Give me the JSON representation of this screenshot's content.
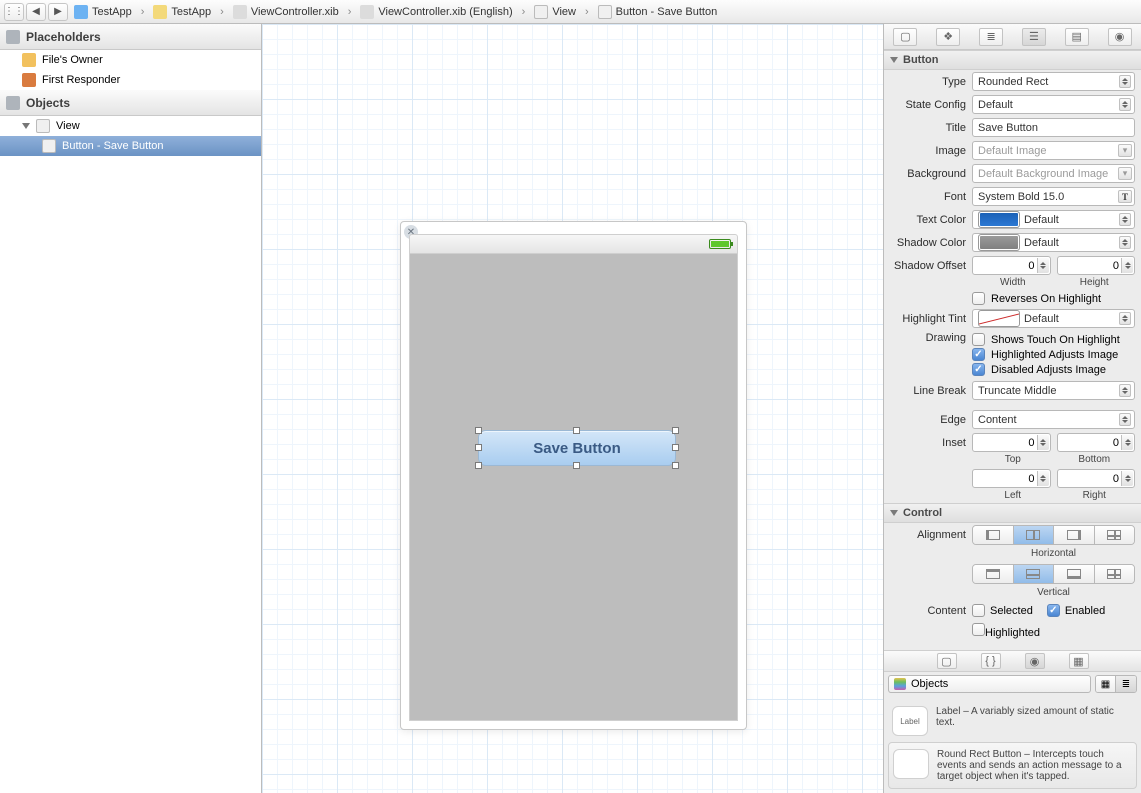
{
  "breadcrumb": {
    "items": [
      {
        "label": "TestApp"
      },
      {
        "label": "TestApp"
      },
      {
        "label": "ViewController.xib"
      },
      {
        "label": "ViewController.xib (English)"
      },
      {
        "label": "View"
      },
      {
        "label": "Button - Save Button"
      }
    ]
  },
  "outline": {
    "placeholders_title": "Placeholders",
    "files_owner": "File's Owner",
    "first_responder": "First Responder",
    "objects_title": "Objects",
    "view": "View",
    "button_item": "Button - Save Button"
  },
  "canvas": {
    "button_title": "Save Button"
  },
  "inspector": {
    "section_button": "Button",
    "type_label": "Type",
    "type_value": "Rounded Rect",
    "stateconfig_label": "State Config",
    "stateconfig_value": "Default",
    "title_label": "Title",
    "title_value": "Save Button",
    "image_label": "Image",
    "image_placeholder": "Default Image",
    "background_label": "Background",
    "background_placeholder": "Default Background Image",
    "font_label": "Font",
    "font_value": "System Bold 15.0",
    "textcolor_label": "Text Color",
    "textcolor_value": "Default",
    "shadowcolor_label": "Shadow Color",
    "shadowcolor_value": "Default",
    "shadowoffset_label": "Shadow Offset",
    "shadowoffset_width": "0",
    "shadowoffset_height": "0",
    "shadowoffset_w_lbl": "Width",
    "shadowoffset_h_lbl": "Height",
    "reverses_label": "Reverses On Highlight",
    "highlight_tint_label": "Highlight Tint",
    "highlight_tint_value": "Default",
    "drawing_label": "Drawing",
    "shows_touch": "Shows Touch On Highlight",
    "hl_adjusts": "Highlighted Adjusts Image",
    "dis_adjusts": "Disabled Adjusts Image",
    "linebreak_label": "Line Break",
    "linebreak_value": "Truncate Middle",
    "edge_label": "Edge",
    "edge_value": "Content",
    "inset_label": "Inset",
    "inset_top": "0",
    "inset_bottom": "0",
    "inset_top_lbl": "Top",
    "inset_bottom_lbl": "Bottom",
    "inset_left": "0",
    "inset_right": "0",
    "inset_left_lbl": "Left",
    "inset_right_lbl": "Right",
    "section_control": "Control",
    "alignment_label": "Alignment",
    "horizontal": "Horizontal",
    "vertical": "Vertical",
    "content_label": "Content",
    "selected": "Selected",
    "enabled": "Enabled",
    "highlighted": "Highlighted"
  },
  "library": {
    "objects_label": "Objects",
    "label_title": "Label",
    "label_desc": "Label – A variably sized amount of static text.",
    "button_title": "Round Rect Button",
    "button_desc": "Round Rect Button – Intercepts touch events and sends an action message to a target object when it's tapped."
  }
}
